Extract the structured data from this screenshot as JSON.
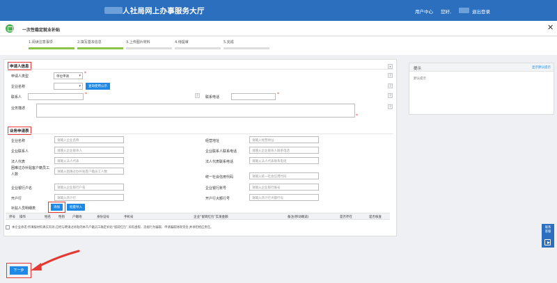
{
  "header": {
    "site_title": "人社局网上办事服务大厅",
    "user_center": "用户中心",
    "greeting": "您好,",
    "logout": "退出登录",
    "bg_color": "#2c6fbf"
  },
  "page": {
    "title": "一次性稳定就业补贴",
    "close_icon": "close-icon"
  },
  "steps": [
    {
      "label": "1.阅读注意事项",
      "done": true
    },
    {
      "label": "2.填写基本信息",
      "done": true
    },
    {
      "label": "3.上传图片材料",
      "done": false
    },
    {
      "label": "4.待提审",
      "done": false
    },
    {
      "label": "5.完成",
      "done": false
    }
  ],
  "applicant_section": {
    "title": "申请人信息",
    "type_label": "申请人类型",
    "type_value": "单位申请",
    "company_label": "企业名称",
    "company_button": "查询使用公示",
    "contact_label": "联系人",
    "phone_label": "联系电话",
    "desc_label": "业务描述"
  },
  "business_section": {
    "title": "业务申请表",
    "fields": [
      {
        "label": "企业名称",
        "placeholder": "请输入企业名称"
      },
      {
        "label": "经营地址",
        "placeholder": "请输入经营地址"
      },
      {
        "label": "企业联系人",
        "placeholder": "请输入企业联系人"
      },
      {
        "label": "企业联系人联系电话",
        "placeholder": "请输入企业联系人联系电话"
      },
      {
        "label": "法人代表",
        "placeholder": "请输入法人代表"
      },
      {
        "label": "法人代表联系电话",
        "placeholder": "请输入法人代表联系电话"
      },
      {
        "label": "困难过办补贴客户籍员工人数",
        "placeholder": "请输入困难过办补贴客户籍员工人数"
      },
      {
        "label": "统一社会信用代码",
        "placeholder": "请输入统一社会信用代码"
      },
      {
        "label": "企业银行户名",
        "placeholder": "请输入企业银行户名"
      },
      {
        "label": "企业银行账号",
        "placeholder": "请输入企业银行账号"
      },
      {
        "label": "开户行",
        "placeholder": "请输入开户行"
      },
      {
        "label": "开户行大额行号",
        "placeholder": "请输入开户行大额行号"
      }
    ],
    "subsidy_list_label": "补贴人员明细表",
    "add_button": "添加",
    "batch_import_button": "批量导入"
  },
  "table": {
    "columns": [
      "序号",
      "操作",
      "姓名",
      "性别",
      "户籍地",
      "身份证号",
      "手机号",
      "企业“留岗红包”实发金额",
      "备注(移动端说)",
      "是否存在",
      "是否核查"
    ]
  },
  "agreement": {
    "text": "本企业承诺:所填报材料真实有效,已经与聘请过补贴的本市户籍员工确定补贴“留岗红包”,如有虚假、违规行为骗取、申请骗取财政资金,并承担相应责任。"
  },
  "side_panel": {
    "title": "提示",
    "link": "显示默认提示",
    "body": "默认提示"
  },
  "float_widget": {
    "label_line1": "联系",
    "label_line2": "客服",
    "icon": "play-icon"
  },
  "footer": {
    "next_button": "下一步"
  },
  "colors": {
    "accent": "#1e88e5",
    "highlight": "#e53935",
    "progress_done": "#8bc34a"
  }
}
